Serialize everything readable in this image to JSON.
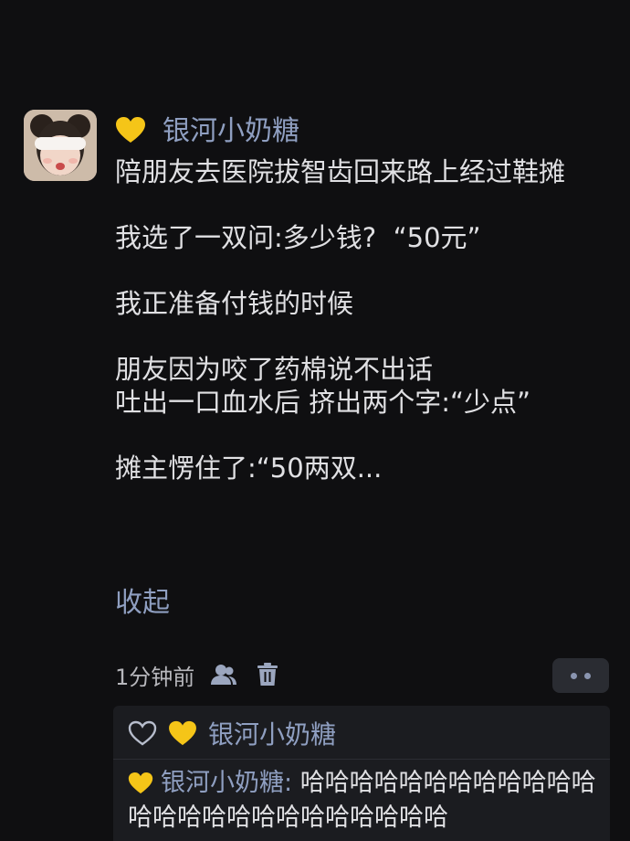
{
  "post": {
    "username": "银河小奶糖",
    "badge_icon": "yellow-heart-icon",
    "badge_color": "#f5c518",
    "text": "陪朋友去医院拔智齿回来路上经过鞋摊\n\n我选了一双问:多少钱?  “50元”\n\n我正准备付钱的时候\n\n朋友因为咬了药棉说不出话\n吐出一口血水后 挤出两个字:“少点”\n\n摊主愣住了:“50两双...",
    "collapse_label": "收起"
  },
  "meta": {
    "time": "1分钟前",
    "icons": [
      "user-icon",
      "trash-icon",
      "more-icon"
    ]
  },
  "likes": {
    "icon": "heart-outline-icon",
    "username": "银河小奶糖"
  },
  "comment": {
    "username": "银河小奶糖",
    "separator": ": ",
    "text": "哈哈哈哈哈哈哈哈哈哈哈哈哈哈哈哈哈哈哈哈哈哈哈哈哈"
  },
  "colors": {
    "background": "#0f0f11",
    "link": "#8f9fc1",
    "panel": "#1b1c20"
  }
}
